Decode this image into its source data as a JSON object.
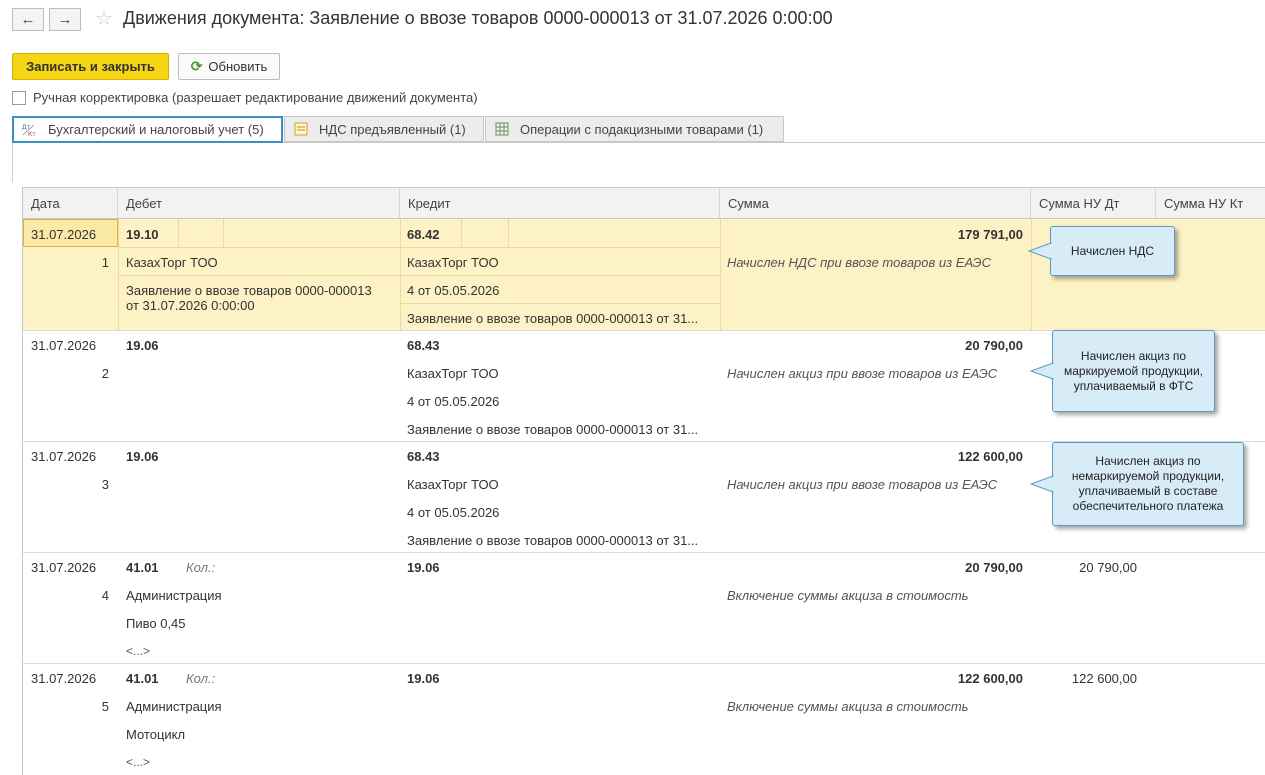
{
  "header": {
    "back_icon": "←",
    "forward_icon": "→",
    "star_icon": "☆",
    "title": "Движения документа: Заявление о ввозе товаров 0000-000013 от 31.07.2026 0:00:00"
  },
  "toolbar": {
    "save_close_label": "Записать и закрыть",
    "refresh_label": "Обновить",
    "refresh_icon": "⟳"
  },
  "manual_correction": {
    "checked": false,
    "label": "Ручная корректировка (разрешает редактирование движений документа)"
  },
  "tabs": [
    {
      "label": "Бухгалтерский и налоговый учет (5)",
      "icon": "accounting-dt-kt-icon",
      "active": true
    },
    {
      "label": "НДС предъявленный (1)",
      "icon": "vat-register-icon",
      "active": false
    },
    {
      "label": "Операции с подакцизными товарами (1)",
      "icon": "excise-register-icon",
      "active": false
    }
  ],
  "table": {
    "columns": [
      "Дата",
      "Дебет",
      "Кредит",
      "Сумма",
      "Сумма НУ Дт",
      "Сумма НУ Кт"
    ],
    "rows": [
      {
        "date": "31.07.2026",
        "num": "1",
        "debit_account": "19.10",
        "debit_qty_label": "",
        "debit_lines": [
          "КазахТорг ТОО",
          "Заявление о ввозе товаров 0000-000013",
          "от 31.07.2026 0:00:00"
        ],
        "credit_account": "68.42",
        "credit_lines": [
          "КазахТорг ТОО",
          "4 от 05.05.2026",
          "Заявление о ввозе товаров 0000-000013 от 31..."
        ],
        "amount": "179 791,00",
        "content": "Начислен НДС при ввозе товаров из ЕАЭС",
        "nu_dt": "",
        "nu_kt": "",
        "selected": true
      },
      {
        "date": "31.07.2026",
        "num": "2",
        "debit_account": "19.06",
        "debit_qty_label": "",
        "debit_lines": [],
        "credit_account": "68.43",
        "credit_lines": [
          "КазахТорг ТОО",
          "4 от 05.05.2026",
          "Заявление о ввозе товаров 0000-000013 от 31..."
        ],
        "amount": "20 790,00",
        "content": "Начислен акциз при ввозе товаров из ЕАЭС",
        "nu_dt": "",
        "nu_kt": "",
        "selected": false
      },
      {
        "date": "31.07.2026",
        "num": "3",
        "debit_account": "19.06",
        "debit_qty_label": "",
        "debit_lines": [],
        "credit_account": "68.43",
        "credit_lines": [
          "КазахТорг ТОО",
          "4 от 05.05.2026",
          "Заявление о ввозе товаров 0000-000013 от 31..."
        ],
        "amount": "122 600,00",
        "content": "Начислен акциз при ввозе товаров из ЕАЭС",
        "nu_dt": "",
        "nu_kt": "",
        "selected": false
      },
      {
        "date": "31.07.2026",
        "num": "4",
        "debit_account": "41.01",
        "debit_qty_label": "Кол.:",
        "debit_lines": [
          "Администрация",
          "Пиво 0,45",
          "<...>"
        ],
        "credit_account": "19.06",
        "credit_lines": [],
        "amount": "20 790,00",
        "content": "Включение суммы акциза в стоимость",
        "nu_dt": "20 790,00",
        "nu_kt": "",
        "selected": false
      },
      {
        "date": "31.07.2026",
        "num": "5",
        "debit_account": "41.01",
        "debit_qty_label": "Кол.:",
        "debit_lines": [
          "Администрация",
          "Мотоцикл",
          "<...>"
        ],
        "credit_account": "19.06",
        "credit_lines": [],
        "amount": "122 600,00",
        "content": "Включение суммы акциза в стоимость",
        "nu_dt": "122 600,00",
        "nu_kt": "",
        "selected": false
      }
    ]
  },
  "callouts": [
    {
      "text": "Начислен НДС"
    },
    {
      "text": "Начислен акциз по маркируемой продукции, уплачиваемый в ФТС"
    },
    {
      "text": "Начислен акциз по немаркируемой продукции, уплачиваемый в составе обеспечительного платежа"
    }
  ],
  "colors": {
    "accent_yellow": "#f5d514",
    "selected_row": "#fcf2c6",
    "tab_active_border": "#3a8fc4",
    "callout_bg": "#d7ecf7"
  }
}
